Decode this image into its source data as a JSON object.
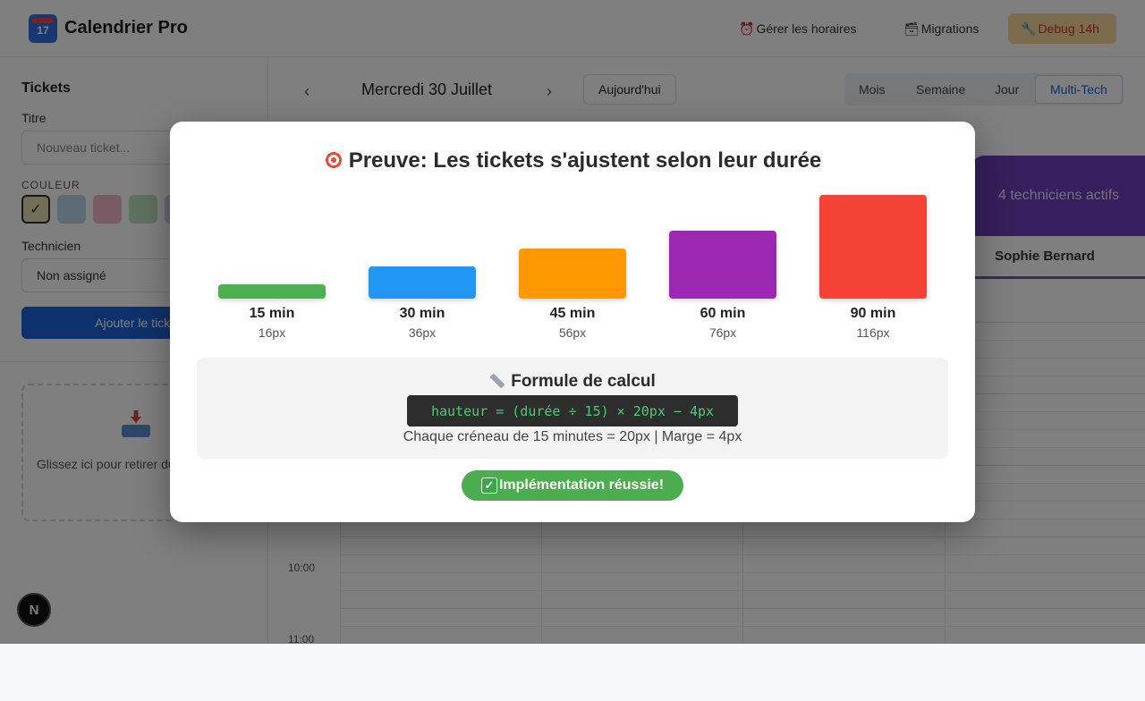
{
  "app": {
    "title": "Calendrier Pro",
    "logo_day": "17",
    "nav": [
      {
        "icon": "⏰",
        "label": "Gérer les horaires"
      },
      {
        "icon": "🗃",
        "label": "Migrations"
      },
      {
        "icon": "🔧",
        "label": "Debug 14h"
      }
    ]
  },
  "sidebar": {
    "heading": "Tickets",
    "title_label": "Titre",
    "title_placeholder": "Nouveau ticket...",
    "color_label": "COULEUR",
    "selected_mark": "✓",
    "swatch_colors": [
      "#e6ddb0",
      "#b9d7ec",
      "#f2b8c6",
      "#bfe3bf",
      "#d6c6ec"
    ],
    "technician_label": "Technicien",
    "technician_value": "Non assigné",
    "add_button": "Ajouter le ticket",
    "dropzone_text": "Glissez ici pour retirer du calendrier"
  },
  "calendar": {
    "prev": "‹",
    "next": "›",
    "date": "Mercredi 30 Juillet",
    "today": "Aujourd'hui",
    "views": [
      "Mois",
      "Semaine",
      "Jour",
      "Multi-Tech"
    ],
    "active_view": "Multi-Tech",
    "active_techs": "4 techniciens actifs",
    "tech_name": "Sophie Bernard",
    "times": [
      "10:00",
      "11:00"
    ]
  },
  "modal": {
    "title": "Preuve: Les tickets s'ajustent selon leur durée",
    "bars": [
      {
        "label": "15 min",
        "px_label": "16px",
        "height": 16,
        "color": "#4caf50"
      },
      {
        "label": "30 min",
        "px_label": "36px",
        "height": 36,
        "color": "#2196f3"
      },
      {
        "label": "45 min",
        "px_label": "56px",
        "height": 56,
        "color": "#ff9800"
      },
      {
        "label": "60 min",
        "px_label": "76px",
        "height": 76,
        "color": "#9c27b0"
      },
      {
        "label": "90 min",
        "px_label": "116px",
        "height": 116,
        "color": "#f44336"
      }
    ],
    "formula_title": "Formule de calcul",
    "formula_code": "hauteur = (durée ÷ 15) × 20px − 4px",
    "formula_note": "Chaque créneau de 15 minutes = 20px | Marge = 4px",
    "success_mark": "✓",
    "success_label": "Implémentation réussie!"
  },
  "devtools": {
    "badge": "N"
  }
}
